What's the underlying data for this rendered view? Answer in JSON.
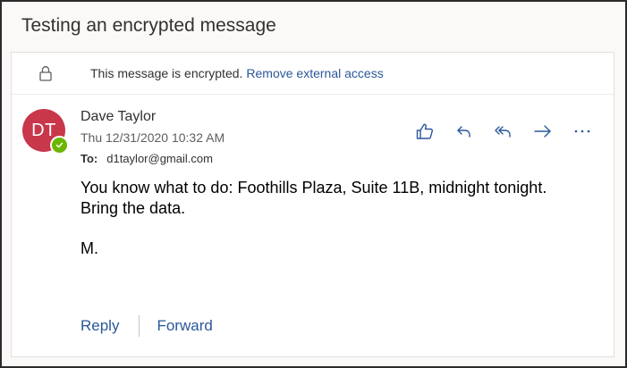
{
  "subject": "Testing an encrypted message",
  "encryption": {
    "icon": "lock-icon",
    "message": "This message is encrypted.",
    "link": "Remove external access"
  },
  "sender": {
    "initials": "DT",
    "name": "Dave Taylor",
    "date": "Thu 12/31/2020 10:32 AM",
    "to_label": "To:",
    "to": "d1taylor@gmail.com",
    "avatar_color": "#c8374a",
    "presence_color": "#6bb700"
  },
  "actions": [
    "like-icon",
    "reply-icon",
    "reply-all-icon",
    "forward-icon",
    "more-icon"
  ],
  "body": {
    "line1": "You know what to do: Foothills Plaza, Suite 11B, midnight tonight.",
    "line2": "Bring the data.",
    "signature": "M."
  },
  "footer": {
    "reply": "Reply",
    "forward": "Forward"
  },
  "colors": {
    "accent": "#2b579a",
    "action_icon": "#2b579a"
  }
}
